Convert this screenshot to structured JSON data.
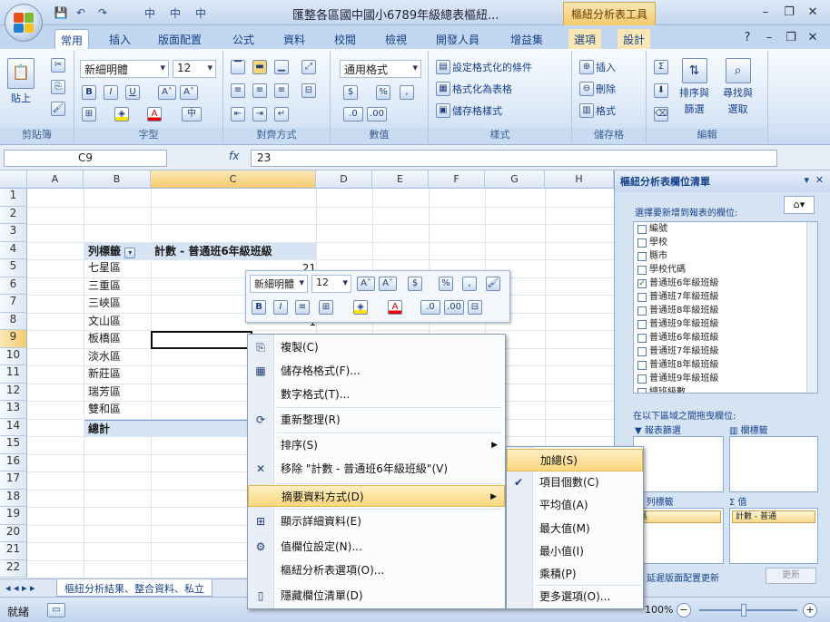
{
  "window": {
    "title": "匯整各區國中國小6789年級總表樞紐...",
    "context_tab_title": "樞紐分析表工具",
    "controls": {
      "minimize": "–",
      "restore": "❐",
      "close": "✕"
    }
  },
  "quick_access": {
    "save": "💾",
    "undo": "↶",
    "redo": "↷",
    "extra": [
      "中",
      "中",
      "中"
    ]
  },
  "tabs": [
    {
      "label": "常用",
      "active": true
    },
    {
      "label": "插入"
    },
    {
      "label": "版面配置"
    },
    {
      "label": "公式"
    },
    {
      "label": "資料"
    },
    {
      "label": "校閱"
    },
    {
      "label": "檢視"
    },
    {
      "label": "開發人員"
    },
    {
      "label": "增益集"
    },
    {
      "label": "選項",
      "context": true
    },
    {
      "label": "設計",
      "context": true
    }
  ],
  "ribbon": {
    "clipboard": {
      "label": "剪貼簿",
      "paste": "貼上"
    },
    "font": {
      "label": "字型",
      "name": "新細明體",
      "size": "12",
      "bold": "B",
      "italic": "I",
      "underline": "U",
      "grow": "A˄",
      "shrink": "A˅"
    },
    "alignment": {
      "label": "對齊方式"
    },
    "number": {
      "label": "數值",
      "format": "通用格式",
      "currency": "$",
      "percent": "%",
      "comma": ","
    },
    "styles": {
      "label": "樣式",
      "conditional": "設定格式化的條件",
      "as_table": "格式化為表格",
      "cell_styles": "儲存格樣式"
    },
    "cells": {
      "label": "儲存格",
      "insert": "插入",
      "delete": "刪除",
      "format": "格式"
    },
    "editing": {
      "label": "編輯",
      "sum": "Σ",
      "sort": "排序與",
      "filter": "篩選",
      "find": "尋找與",
      "select": "選取"
    }
  },
  "formula_bar": {
    "name_box": "C9",
    "fx": "fx",
    "value": "23"
  },
  "columns": [
    "A",
    "B",
    "C",
    "D",
    "E",
    "F",
    "G",
    "H"
  ],
  "rows": [
    "1",
    "2",
    "3",
    "4",
    "5",
    "6",
    "7",
    "8",
    "9",
    "10",
    "11",
    "12",
    "13",
    "14",
    "15",
    "16",
    "17",
    "18",
    "19",
    "20",
    "21",
    "22"
  ],
  "pivot": {
    "row_label_header": "列標籤",
    "value_header": "計數 - 普通班6年級班級",
    "rows": [
      "七星區",
      "三重區",
      "三峽區",
      "文山區",
      "板橋區",
      "淡水區",
      "新莊區",
      "瑞芳區",
      "雙和區"
    ],
    "total_label": "總計",
    "visible_value_c5": "21",
    "visible_value_c8": "1"
  },
  "sheet_tabs": {
    "nav": "◂ ◂ ▸ ▸",
    "active": "樞紐分析結果、整合資料、私立"
  },
  "status_bar": {
    "mode": "就緒",
    "zoom": "100%"
  },
  "mini_toolbar": {
    "font": "新細明體",
    "size": "12",
    "grow": "A˄",
    "shrink": "A˅",
    "currency": "$",
    "percent": "%",
    "comma": ",",
    "bold": "B",
    "italic": "I"
  },
  "context_menu": {
    "items": [
      {
        "label": "複製(C)",
        "icon": "copy-icon",
        "glyph": "⎘"
      },
      {
        "label": "儲存格格式(F)...",
        "icon": "format-icon",
        "glyph": "▦"
      },
      {
        "label": "數字格式(T)...",
        "icon": "",
        "glyph": ""
      },
      {
        "label": "重新整理(R)",
        "icon": "refresh-icon",
        "glyph": "⟳"
      },
      {
        "label": "排序(S)",
        "icon": "",
        "glyph": "",
        "submenu": true
      },
      {
        "label": "移除 \"計數 - 普通班6年級班級\"(V)",
        "icon": "remove-icon",
        "glyph": "✕"
      },
      {
        "label": "摘要資料方式(D)",
        "icon": "",
        "glyph": "",
        "submenu": true,
        "highlight": true
      },
      {
        "label": "顯示詳細資料(E)",
        "icon": "details-icon",
        "glyph": "⊞"
      },
      {
        "label": "值欄位設定(N)...",
        "icon": "settings-icon",
        "glyph": "⚙"
      },
      {
        "label": "樞紐分析表選項(O)...",
        "icon": "",
        "glyph": ""
      },
      {
        "label": "隱藏欄位清單(D)",
        "icon": "field-list-icon",
        "glyph": "▯"
      }
    ]
  },
  "submenu": {
    "items": [
      {
        "label": "加總(S)",
        "highlight": true
      },
      {
        "label": "項目個數(C)",
        "checked": true
      },
      {
        "label": "平均值(A)"
      },
      {
        "label": "最大值(M)"
      },
      {
        "label": "最小值(I)"
      },
      {
        "label": "乘積(P)"
      },
      {
        "label": "更多選項(O)..."
      }
    ]
  },
  "task_pane": {
    "title": "樞紐分析表欄位清單",
    "choose_label": "選擇要新增到報表的欄位:",
    "fields": [
      {
        "label": "編號",
        "checked": false
      },
      {
        "label": "學校",
        "checked": false
      },
      {
        "label": "縣市",
        "checked": false
      },
      {
        "label": "學校代碼",
        "checked": false
      },
      {
        "label": "普通班6年級班級",
        "checked": true
      },
      {
        "label": "普通班7年級班級",
        "checked": false
      },
      {
        "label": "普通班8年級班級",
        "checked": false
      },
      {
        "label": "普通班9年級班級",
        "checked": false
      },
      {
        "label": "普通班6年級班級",
        "checked": false
      },
      {
        "label": "普通班7年級班級",
        "checked": false
      },
      {
        "label": "普通班8年級班級",
        "checked": false
      },
      {
        "label": "普通班9年級班級",
        "checked": false
      },
      {
        "label": "總班級數",
        "checked": false
      }
    ],
    "drag_label": "在以下區域之間拖曳欄位:",
    "report_filter": "報表篩選",
    "column_labels": "欄標籤",
    "row_labels": "列標籤",
    "values": "Σ 值",
    "row_chip": "區",
    "value_chip": "計數 - 普通",
    "defer_label": "延遲版面配置更新",
    "update_btn": "更新"
  }
}
